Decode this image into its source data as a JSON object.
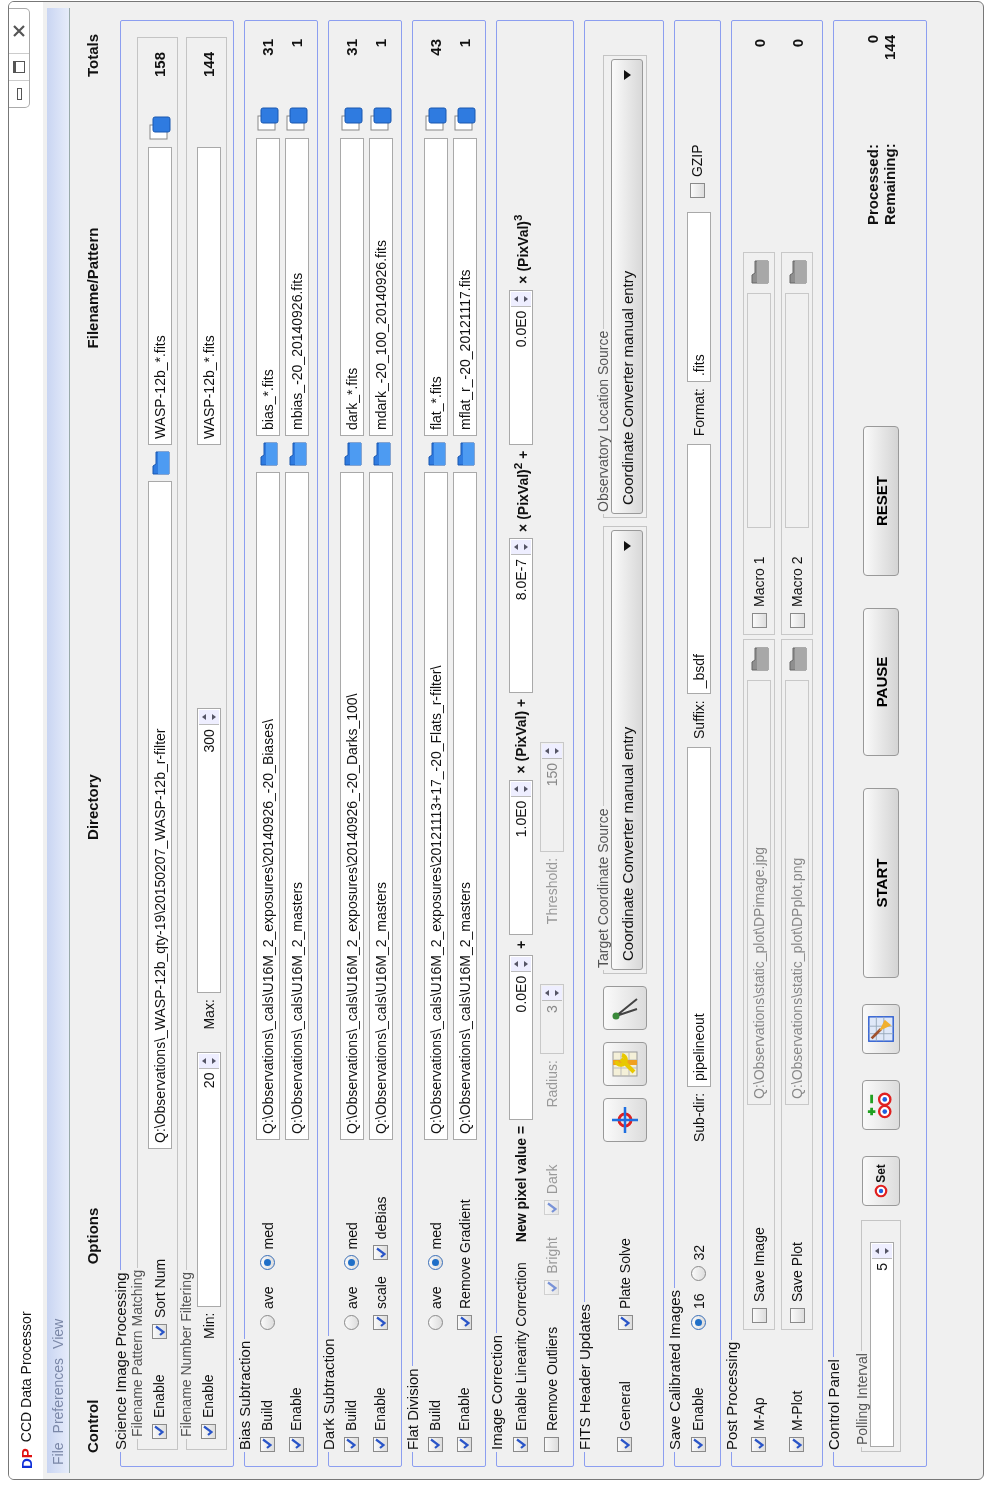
{
  "window": {
    "logo": "DP",
    "title": "CCD Data Processor"
  },
  "menu": [
    "File",
    "Preferences",
    "View"
  ],
  "columns": [
    "Control",
    "Options",
    "Directory",
    "Filename/Pattern",
    "Totals"
  ],
  "sections": [
    {
      "kind": "science",
      "title": "Science Image Processing",
      "groups": [
        {
          "title": "Filename Pattern Matching",
          "checks": [
            {
              "label": "Enable",
              "checked": true
            },
            {
              "label": "Sort Num",
              "checked": true
            }
          ],
          "directory": "Q:\\Observations\\_WASP-12b_qty-19\\20150207_WASP-12b_r-filter",
          "filename": "WASP-12b_*.fits",
          "total": "158"
        },
        {
          "title": "Filename Number Filtering",
          "checks": [
            {
              "label": "Enable",
              "checked": true
            }
          ],
          "min_label": "Min:",
          "min": "20",
          "max_label": "Max:",
          "max": "300",
          "filename": "WASP-12b_*.fits",
          "total": "144"
        }
      ]
    },
    {
      "kind": "calib",
      "title": "Bias Subtraction",
      "rows": [
        {
          "check": {
            "label": "Build",
            "checked": true
          },
          "options": [
            {
              "kind": "radio",
              "label": "ave",
              "selected": false
            },
            {
              "kind": "radio",
              "label": "med",
              "selected": true
            }
          ],
          "directory": "Q:\\Observations\\_cals\\U16M_2_exposures\\20140926_-20_Biases\\",
          "filename": "bias_*.fits",
          "total": "31"
        },
        {
          "check": {
            "label": "Enable",
            "checked": true
          },
          "options": [],
          "directory": "Q:\\Observations\\_cals\\U16M_2_masters",
          "filename": "mbias_-20_20140926.fits",
          "total": "1"
        }
      ]
    },
    {
      "kind": "calib",
      "title": "Dark Subtraction",
      "rows": [
        {
          "check": {
            "label": "Build",
            "checked": true
          },
          "options": [
            {
              "kind": "radio",
              "label": "ave",
              "selected": false
            },
            {
              "kind": "radio",
              "label": "med",
              "selected": true
            }
          ],
          "directory": "Q:\\Observations\\_cals\\U16M_2_exposures\\20140926_-20_Darks_100\\",
          "filename": "dark_*.fits",
          "total": "31"
        },
        {
          "check": {
            "label": "Enable",
            "checked": true
          },
          "options": [
            {
              "kind": "check",
              "label": "scale",
              "checked": true
            },
            {
              "kind": "check",
              "label": "deBias",
              "checked": true
            }
          ],
          "directory": "Q:\\Observations\\_cals\\U16M_2_masters",
          "filename": "mdark_-20_100_20140926.fits",
          "total": "1"
        }
      ]
    },
    {
      "kind": "calib",
      "title": "Flat Division",
      "rows": [
        {
          "check": {
            "label": "Build",
            "checked": true
          },
          "options": [
            {
              "kind": "radio",
              "label": "ave",
              "selected": false
            },
            {
              "kind": "radio",
              "label": "med",
              "selected": true
            }
          ],
          "directory": "Q:\\Observations\\_cals\\U16M_2_exposures\\20121113+17_-20_Flats_r-filter\\",
          "filename": "flat_*.fits",
          "total": "43"
        },
        {
          "check": {
            "label": "Enable",
            "checked": true
          },
          "options": [
            {
              "kind": "check",
              "label": "Remove Gradient",
              "checked": true
            }
          ],
          "directory": "Q:\\Observations\\_cals\\U16M_2_masters",
          "filename": "mflat_r_-20_20121117.fits",
          "total": "1"
        }
      ]
    },
    {
      "kind": "correction",
      "title": "Image Correction",
      "linearity": {
        "check": {
          "label": "Enable Linearity Correction",
          "checked": true
        },
        "label": "New pixel value =",
        "terms": [
          {
            "value": "0.0E0",
            "suffix": "+"
          },
          {
            "value": "1.0E0",
            "suffix": "× (PixVal) +"
          },
          {
            "value": "8.0E-7",
            "suffix": "× (PixVal)$^{2}$ +"
          },
          {
            "value": "0.0E0",
            "suffix": "× (PixVal)$^{3}$"
          }
        ]
      },
      "outliers": {
        "check": {
          "label": "Remove Outliers",
          "checked": false
        },
        "options": [
          {
            "label": "Bright",
            "checked": true,
            "disabled": true
          },
          {
            "label": "Dark",
            "checked": true,
            "disabled": true
          }
        ],
        "params": [
          {
            "label": "Radius:",
            "value": "3",
            "disabled": true
          },
          {
            "label": "Threshold:",
            "value": "150",
            "disabled": true
          }
        ]
      }
    },
    {
      "kind": "fits",
      "title": "FITS Header Updates",
      "checks": [
        {
          "label": "General",
          "checked": true
        },
        {
          "label": "Plate Solve",
          "checked": true
        }
      ],
      "tools": [
        {
          "kind": "target"
        },
        {
          "kind": "wrench"
        },
        {
          "kind": "compass"
        }
      ],
      "sources": [
        {
          "title": "Target Coordinate Source",
          "value": "Coordinate Converter manual entry"
        },
        {
          "title": "Observatory Location Source",
          "value": "Coordinate Converter manual entry"
        }
      ]
    },
    {
      "kind": "save",
      "title": "Save Calibrated Images",
      "check": {
        "label": "Enable",
        "checked": true
      },
      "bits": [
        {
          "label": "16",
          "selected": true
        },
        {
          "label": "32",
          "selected": false
        }
      ],
      "fields": [
        {
          "label": "Sub-dir:",
          "value": "pipelineout"
        },
        {
          "label": "Suffix:",
          "value": "_bsdf"
        },
        {
          "label": "Format:",
          "value": ".fits"
        }
      ],
      "gzip": {
        "label": "GZIP",
        "checked": false
      }
    },
    {
      "kind": "post",
      "title": "Post Processing",
      "rows": [
        {
          "check": {
            "label": "M-Ap",
            "checked": true
          },
          "save": {
            "label": "Save Image",
            "checked": false
          },
          "path": "Q:\\Observations\\static_plot\\DPimage.jpg",
          "macro": {
            "label": "Macro 1",
            "checked": false
          },
          "total": "0"
        },
        {
          "check": {
            "label": "M-Plot",
            "checked": true
          },
          "save": {
            "label": "Save Plot",
            "checked": false
          },
          "path": "Q:\\Observations\\static_plot\\DPplot.png",
          "macro": {
            "label": "Macro 2",
            "checked": false
          },
          "total": "0"
        }
      ]
    },
    {
      "kind": "control",
      "title": "Control Panel",
      "polling": {
        "title": "Polling Interval",
        "value": "5"
      },
      "tools": [
        {
          "kind": "set",
          "label": "Set"
        },
        {
          "kind": "plusminus"
        },
        {
          "kind": "broom"
        }
      ],
      "buttons": [
        "START",
        "PAUSE",
        "RESET"
      ],
      "stats": [
        {
          "label": "Processed:",
          "value": "0"
        },
        {
          "label": "Remaining:",
          "value": "144"
        }
      ]
    }
  ]
}
